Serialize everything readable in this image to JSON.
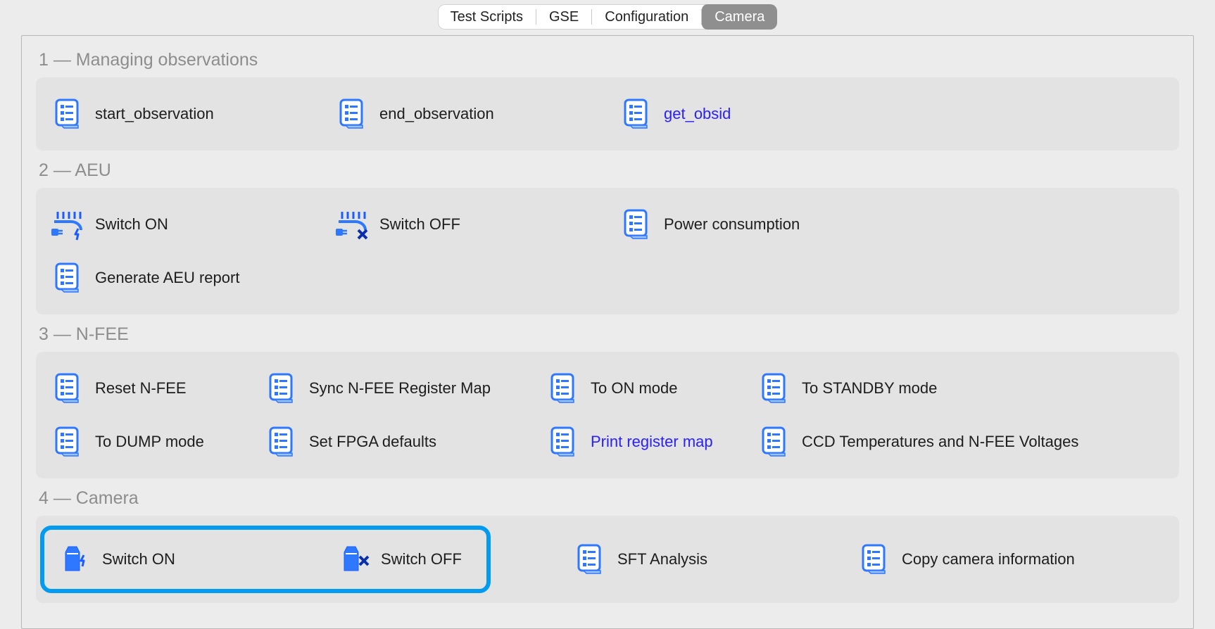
{
  "tabs": [
    "Test Scripts",
    "GSE",
    "Configuration",
    "Camera"
  ],
  "selected_tab_index": 3,
  "sections": [
    {
      "title": "1 — Managing observations",
      "rows": [
        [
          {
            "label": "start_observation",
            "icon": "script",
            "highlight": false,
            "w": "w1"
          },
          {
            "label": "end_observation",
            "icon": "script",
            "highlight": false,
            "w": "w2"
          },
          {
            "label": "get_obsid",
            "icon": "script",
            "highlight": true,
            "w": "w3"
          }
        ]
      ]
    },
    {
      "title": "2 — AEU",
      "rows": [
        [
          {
            "label": "Switch ON",
            "icon": "plug-on",
            "highlight": false,
            "w": "w1"
          },
          {
            "label": "Switch OFF",
            "icon": "plug-off",
            "highlight": false,
            "w": "w2"
          },
          {
            "label": "Power consumption",
            "icon": "script",
            "highlight": false,
            "w": "w3"
          },
          {
            "label": "Generate AEU report",
            "icon": "script",
            "highlight": false,
            "w": "w4"
          }
        ]
      ]
    },
    {
      "title": "3 — N-FEE",
      "rows": [
        [
          {
            "label": "Reset N-FEE",
            "icon": "script",
            "highlight": false,
            "w": "wa"
          },
          {
            "label": "Sync N-FEE Register Map",
            "icon": "script",
            "highlight": false,
            "w": "wb"
          },
          {
            "label": "To ON mode",
            "icon": "script",
            "highlight": false,
            "w": "wc"
          },
          {
            "label": "To STANDBY mode",
            "icon": "script",
            "highlight": false,
            "w": "wd"
          }
        ],
        [
          {
            "label": "To DUMP mode",
            "icon": "script",
            "highlight": false,
            "w": "wa"
          },
          {
            "label": "Set FPGA defaults",
            "icon": "script",
            "highlight": false,
            "w": "wb"
          },
          {
            "label": "Print register map",
            "icon": "script",
            "highlight": true,
            "w": "wc"
          },
          {
            "label": "CCD Temperatures and N-FEE Voltages",
            "icon": "script",
            "highlight": false,
            "w": "wd"
          }
        ]
      ]
    },
    {
      "title": "4 — Camera",
      "rows": [
        [
          {
            "label": "Switch ON",
            "icon": "camera-on",
            "highlight": false,
            "w": "cam1",
            "boxed": true
          },
          {
            "label": "Switch OFF",
            "icon": "camera-off",
            "highlight": false,
            "w": "cam2",
            "boxed": true
          },
          {
            "label": "",
            "icon": "",
            "highlight": false,
            "w": "wempty",
            "spacer": true
          },
          {
            "label": "SFT Analysis",
            "icon": "script",
            "highlight": false,
            "w": "w3"
          },
          {
            "label": "Copy camera information",
            "icon": "script",
            "highlight": false,
            "w": "w4"
          }
        ]
      ]
    }
  ]
}
